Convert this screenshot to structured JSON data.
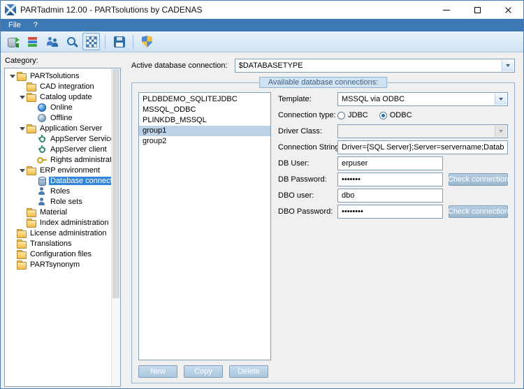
{
  "window": {
    "title": "PARTadmin 12.00 - PARTsolutions by CADENAS"
  },
  "menu": {
    "items": [
      {
        "label": "File"
      },
      {
        "label": "?"
      }
    ]
  },
  "toolbar": {
    "icons": [
      {
        "name": "database-sync-icon"
      },
      {
        "name": "catalog-update-icon"
      },
      {
        "name": "user-administration-icon"
      },
      {
        "name": "index-search-icon"
      },
      {
        "name": "erp-environment-icon",
        "pressed": true
      },
      {
        "name": "save-icon"
      },
      {
        "name": "admin-shield-icon"
      }
    ]
  },
  "sidebar": {
    "label": "Category:",
    "tree": [
      {
        "label": "PARTsolutions",
        "icon": "folder",
        "level": 0,
        "expanded": true
      },
      {
        "label": "CAD integration",
        "icon": "folder",
        "level": 1
      },
      {
        "label": "Catalog update",
        "icon": "folder",
        "level": 1,
        "expanded": true
      },
      {
        "label": "Online",
        "icon": "globe-blue",
        "level": 2
      },
      {
        "label": "Offline",
        "icon": "globe-gray",
        "level": 2
      },
      {
        "label": "Application Server",
        "icon": "folder",
        "level": 1,
        "expanded": true
      },
      {
        "label": "AppServer Service",
        "icon": "gear",
        "level": 2
      },
      {
        "label": "AppServer client",
        "icon": "gear",
        "level": 2
      },
      {
        "label": "Rights administration",
        "icon": "key",
        "level": 2
      },
      {
        "label": "ERP environment",
        "icon": "folder",
        "level": 1,
        "expanded": true
      },
      {
        "label": "Database connection",
        "icon": "database",
        "level": 2,
        "selected": true
      },
      {
        "label": "Roles",
        "icon": "person",
        "level": 2
      },
      {
        "label": "Role sets",
        "icon": "person",
        "level": 2
      },
      {
        "label": "Material",
        "icon": "folder",
        "level": 1
      },
      {
        "label": "Index administration",
        "icon": "folder",
        "level": 1
      },
      {
        "label": "License administration",
        "icon": "folder",
        "level": 0
      },
      {
        "label": "Translations",
        "icon": "folder",
        "level": 0
      },
      {
        "label": "Configuration files",
        "icon": "folder",
        "level": 0
      },
      {
        "label": "PARTsynonym",
        "icon": "folder",
        "level": 0
      }
    ]
  },
  "main": {
    "active_connection": {
      "label": "Active database connection:",
      "value": "$DATABASETYPE"
    },
    "groupbox_title": "Available database connections:",
    "connections": [
      "PLDBDEMO_SQLITEJDBC",
      "MSSQL_ODBC",
      "PLINKDB_MSSQL",
      "group1",
      "group2"
    ],
    "selected_connection": "group1",
    "form": {
      "template": {
        "label": "Template:",
        "value": "MSSQL via ODBC"
      },
      "connection_type": {
        "label": "Connection type:",
        "options": [
          "JDBC",
          "ODBC"
        ],
        "selected": "ODBC"
      },
      "driver_class": {
        "label": "Driver Class:",
        "value": ""
      },
      "connection_string": {
        "label": "Connection String:",
        "value": "Driver={SQL Server};Server=servername;Database=plinkdb"
      },
      "db_user": {
        "label": "DB User:",
        "value": "erpuser"
      },
      "db_password": {
        "label": "DB Password:",
        "value": "•••••••"
      },
      "dbo_user": {
        "label": "DBO user:",
        "value": "dbo"
      },
      "dbo_password": {
        "label": "DBO Password:",
        "value": "••••••••"
      },
      "check_connection_label": "Check connection"
    },
    "list_buttons": [
      "New",
      "Copy",
      "Delete"
    ]
  },
  "colors": {
    "menubar_blue": "#3c78b4",
    "selection_blue": "#3086d8",
    "button_face": "#b9d0e4",
    "groupbox_border": "#92b4d0"
  }
}
